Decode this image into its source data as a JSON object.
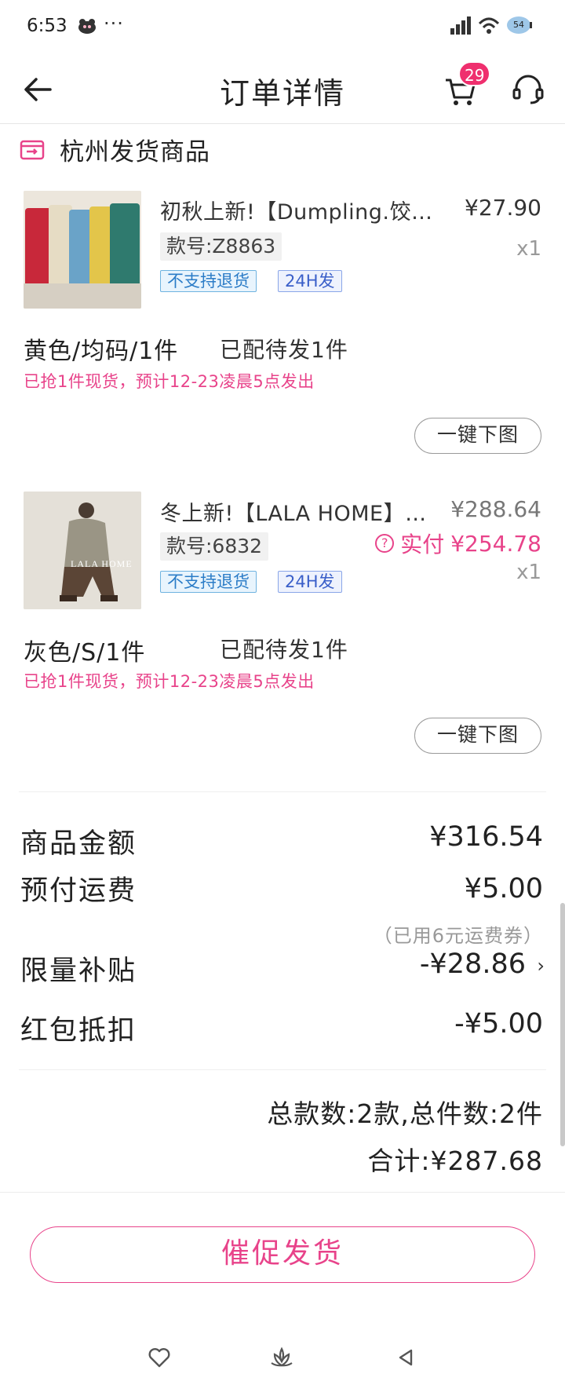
{
  "status_bar": {
    "time": "6:53",
    "dots": "···",
    "battery_badge": "54"
  },
  "header": {
    "title": "订单详情",
    "cart_count": "29"
  },
  "section": {
    "label": "杭州发货商品"
  },
  "products": [
    {
      "title": "初秋上新!【Dumpling.饺子】…",
      "price": "¥27.90",
      "code": "款号:Z8863",
      "qty": "x1",
      "tags": [
        "不支持退货",
        "24H发"
      ],
      "spec": "黄色/均码/1件",
      "allocation": "已配待发1件",
      "notice": "已抢1件现货，预计12-23凌晨5点发出",
      "download_label": "一键下图",
      "image_colors": [
        "#c8283a",
        "#e6dcc4",
        "#6aa3c8",
        "#e3c54a",
        "#2f7a6e"
      ]
    },
    {
      "title": "冬上新!【LALA HOME】…",
      "original_price": "¥288.64",
      "paid_label": "实付",
      "paid_price": "¥254.78",
      "code": "款号:6832",
      "qty": "x1",
      "tags": [
        "不支持退货",
        "24H发"
      ],
      "spec": "灰色/S/1件",
      "allocation": "已配待发1件",
      "notice": "已抢1件现货，预计12-23凌晨5点发出",
      "download_label": "一键下图",
      "image_text": "LALA HOME"
    }
  ],
  "summary": {
    "goods_amount_label": "商品金额",
    "goods_amount": "¥316.54",
    "shipping_label": "预付运费",
    "shipping": "¥5.00",
    "shipping_note": "（已用6元运费券）",
    "subsidy_label": "限量补贴",
    "subsidy": "-¥28.86",
    "redpacket_label": "红包抵扣",
    "redpacket": "-¥5.00",
    "count_text": "总款数:2款,总件数:2件",
    "total_text": "合计:¥287.68"
  },
  "action": {
    "urge_label": "催促发货"
  },
  "colors": {
    "accent": "#e8438a",
    "badge": "#ef2f6e",
    "tag_blue": "#2b7cc7"
  }
}
